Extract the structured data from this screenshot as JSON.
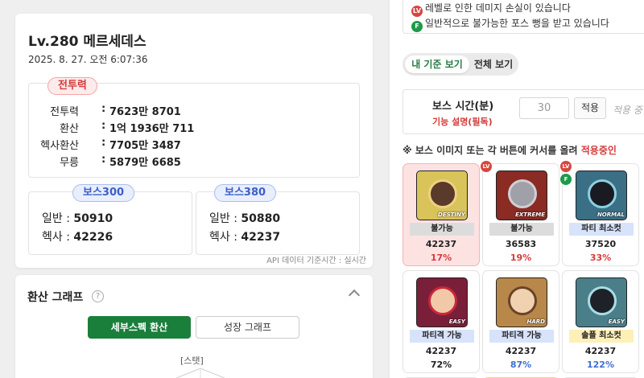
{
  "character": {
    "title": "Lv.280 메르세데스",
    "date": "2025. 8. 27. 오전 6:07:36"
  },
  "combat_power": {
    "pill": "전투력",
    "rows": [
      {
        "label": "전투력",
        "colon": ":",
        "value": "7623만 8701"
      },
      {
        "label": "환산",
        "colon": ":",
        "value": "1억 1936만 711"
      },
      {
        "label": "헥사환산",
        "colon": ":",
        "value": "7705만 3487"
      },
      {
        "label": "무릉",
        "colon": ":",
        "value": "5879만 6685"
      }
    ]
  },
  "boss300": {
    "pill": "보스300",
    "normal_label": "일반 :",
    "normal_value": "50910",
    "hexa_label": "헥사 :",
    "hexa_value": "42226"
  },
  "boss380": {
    "pill": "보스380",
    "normal_label": "일반 :",
    "normal_value": "50880",
    "hexa_label": "헥사 :",
    "hexa_value": "42237"
  },
  "api_note": "API 데이터 기준시간 : 실시간",
  "graph": {
    "title": "환산 그래프",
    "help": "?",
    "btn_detail": "세부스펙 환산",
    "btn_growth": "성장 그래프",
    "stat_label": "[스탯]"
  },
  "notices": {
    "lv_badge": "LV",
    "f_badge": "F",
    "line1": "레벨로 인한 데미지 손실이 있습니다",
    "line2": "일반적으로 불가능한 포스 뻥을 받고 있습니다"
  },
  "view_toggle": {
    "mine": "내 기준 보기",
    "all": "전체 보기"
  },
  "boss_time": {
    "title": "보스 시간(분)",
    "help_link": "기능 설명(필독)",
    "input_value": "30",
    "apply": "적용",
    "after_text": "적용 중"
  },
  "hover_note": {
    "prefix": "※ 보스 이미지 또는 각 버튼에 커서를 올려 ",
    "accent": "적용중인"
  },
  "boss_tiles": [
    {
      "difficulty": "DESTINY",
      "status": "불가능",
      "number": "42237",
      "pct": "17%"
    },
    {
      "difficulty": "EXTREME",
      "status": "불가능",
      "number": "36583",
      "pct": "19%"
    },
    {
      "difficulty": "NORMAL",
      "status": "파티 최소컷",
      "number": "37520",
      "pct": "33%"
    },
    {
      "difficulty": "EASY",
      "status": "파티격 가능",
      "number": "42237",
      "pct": "72%"
    },
    {
      "difficulty": "HARD",
      "status": "파티격 가능",
      "number": "42237",
      "pct": "87%"
    },
    {
      "difficulty": "EASY",
      "status": "솔플 최소컷",
      "number": "42237",
      "pct": "122%"
    }
  ],
  "colors": {
    "accent_green": "#1a7f3b",
    "accent_red": "#d63a3a",
    "accent_blue": "#3b5fc8"
  }
}
